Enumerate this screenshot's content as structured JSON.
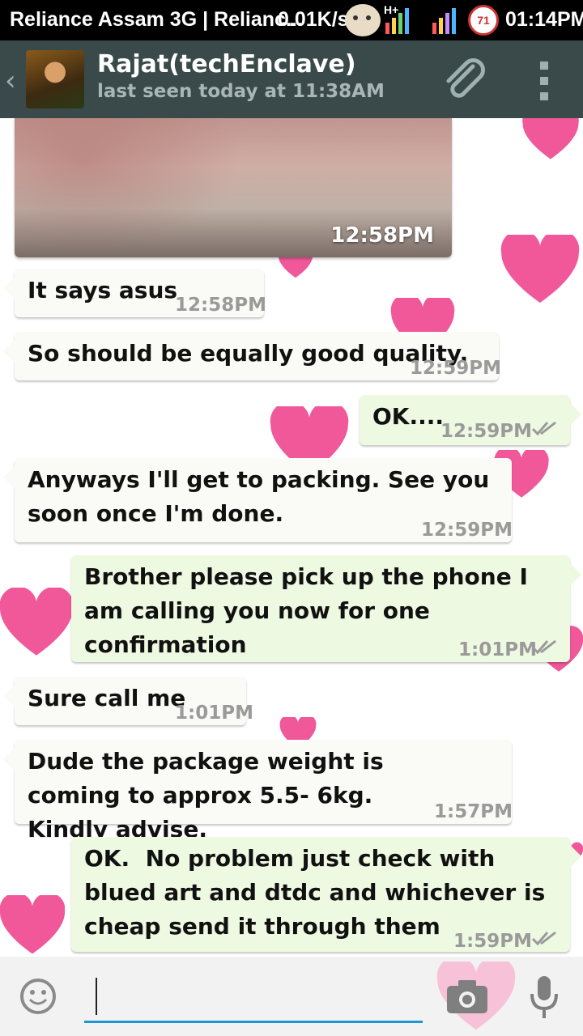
{
  "status_bar": {
    "carrier": "Reliance Assam 3G | Relianc...",
    "speed": "0.01K/s",
    "network": "H+",
    "badge": "71",
    "time": "01:14PM"
  },
  "action_bar": {
    "contact_name": "Rajat(techEnclave)",
    "last_seen": "last seen today at 11:38AM",
    "icons": [
      "back-icon",
      "avatar",
      "attach-icon",
      "menu-icon"
    ]
  },
  "chat": {
    "image_message": {
      "time": "12:58PM"
    },
    "messages": [
      {
        "direction": "in",
        "text": "It says asus",
        "time": "12:58PM"
      },
      {
        "direction": "in",
        "text": "So should be equally good quality.",
        "time": "12:59PM"
      },
      {
        "direction": "out",
        "text": "OK....",
        "time": "12:59PM"
      },
      {
        "direction": "in",
        "text": "Anyways I'll get to packing. See you soon once I'm done.",
        "time": "12:59PM"
      },
      {
        "direction": "out",
        "text": "Brother please pick up the phone I am calling you now for one confirmation",
        "time": "1:01PM"
      },
      {
        "direction": "in",
        "text": "Sure call me",
        "time": "1:01PM"
      },
      {
        "direction": "in",
        "text": "Dude the package weight is coming to approx 5.5- 6kg. Kindly advise.",
        "time": "1:57PM"
      },
      {
        "direction": "out",
        "text": "OK.  No problem just check with blued art and dtdc and whichever is cheap send it through them",
        "time": "1:59PM"
      }
    ]
  },
  "input_bar": {
    "value": "",
    "icons": [
      "emoji-icon",
      "camera-icon",
      "mic-icon"
    ]
  },
  "colors": {
    "action_bar": "#3a4a4a",
    "incoming_bubble": "#fafaf6",
    "outgoing_bubble": "#eef9e2",
    "heart": "#f0589a",
    "input_underline": "#1c97d4"
  }
}
